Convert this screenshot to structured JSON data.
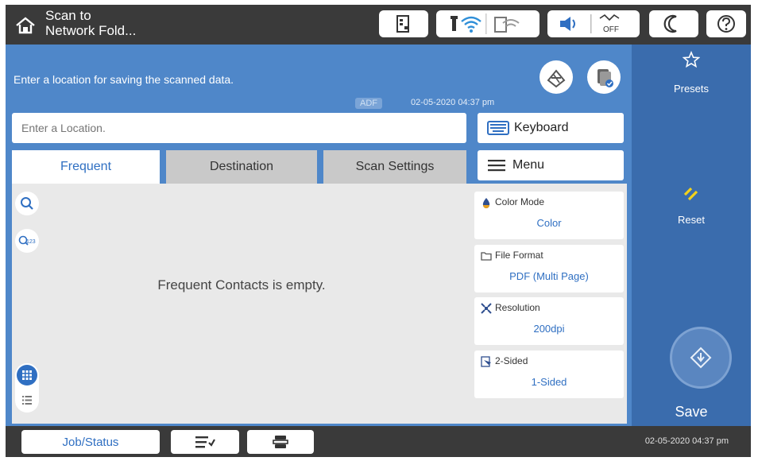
{
  "header": {
    "title_line1": "Scan to",
    "title_line2": "Network Fold..."
  },
  "instruction": "Enter a location for saving the scanned data.",
  "adf_badge": "ADF",
  "datetime_top": "02-05-2020 04:37 pm",
  "location_input": {
    "placeholder": "Enter a Location.",
    "value": ""
  },
  "keyboard_label": "Keyboard",
  "menu_label": "Menu",
  "tabs": [
    {
      "label": "Frequent"
    },
    {
      "label": "Destination"
    },
    {
      "label": "Scan Settings"
    }
  ],
  "empty_message": "Frequent Contacts is empty.",
  "settings": [
    {
      "label": "Color Mode",
      "value": "Color",
      "icon": "color-drop-icon"
    },
    {
      "label": "File Format",
      "value": "PDF (Multi Page)",
      "icon": "folder-icon"
    },
    {
      "label": "Resolution",
      "value": "200dpi",
      "icon": "resolution-icon"
    },
    {
      "label": "2-Sided",
      "value": "1-Sided",
      "icon": "two-sided-icon"
    }
  ],
  "right_panel": {
    "presets_label": "Presets",
    "reset_label": "Reset",
    "save_label": "Save"
  },
  "bottom": {
    "job_status_label": "Job/Status",
    "datetime": "02-05-2020 04:37 pm"
  },
  "colors": {
    "accent": "#2f6fc2",
    "main_blue": "#4f87c9",
    "side_blue": "#3a6cad",
    "reset_yellow": "#f2d21c"
  }
}
